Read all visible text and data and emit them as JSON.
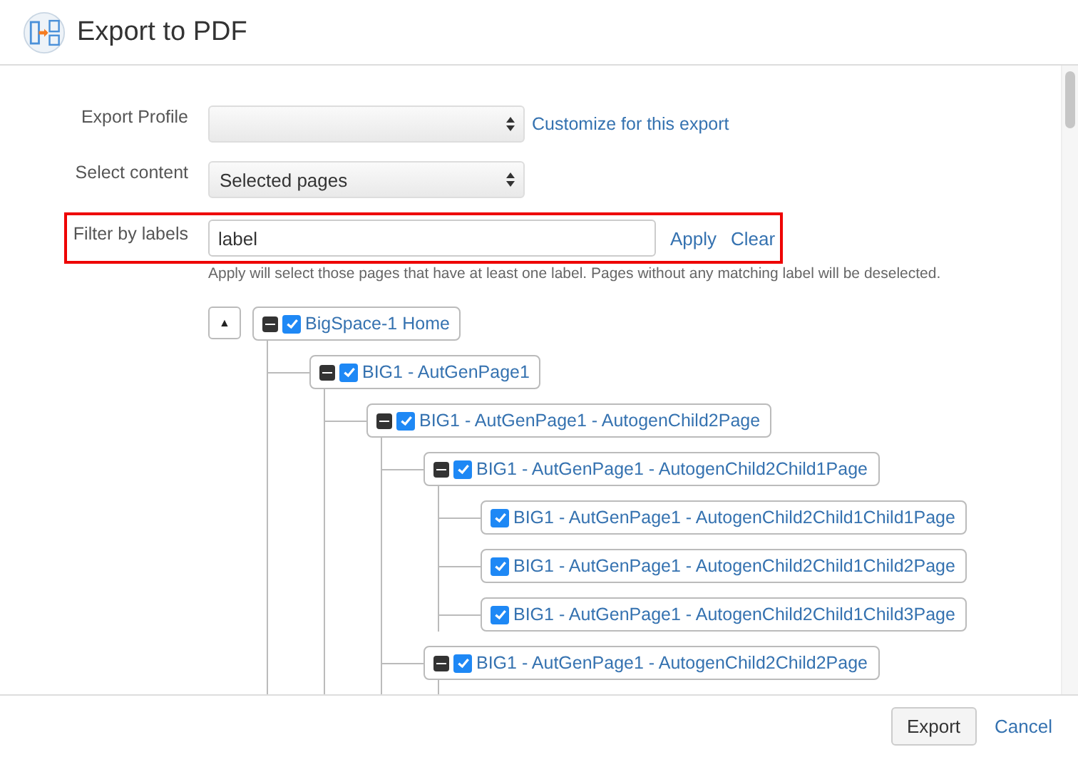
{
  "window": {
    "title": "Export to PDF"
  },
  "form": {
    "export_profile": {
      "label": "Export Profile",
      "link": "Customize for this export"
    },
    "select_content": {
      "label": "Select content",
      "value": "Selected pages"
    },
    "filter": {
      "label": "Filter by labels",
      "value": "label",
      "highlighted": true,
      "apply": "Apply",
      "clear": "Clear",
      "hint": "Apply will select those pages that have at least one label. Pages without any matching label will be deselected."
    }
  },
  "tree": {
    "collapse_button": "▲",
    "nodes": [
      {
        "title": "BigSpace-1 Home",
        "checked": true,
        "expanded": true,
        "children": [
          {
            "title": "BIG1 - AutGenPage1",
            "checked": true,
            "expanded": true,
            "children": [
              {
                "title": "BIG1 - AutGenPage1 - AutogenChild2Page",
                "checked": true,
                "expanded": true,
                "children": [
                  {
                    "title": "BIG1 - AutGenPage1 - AutogenChild2Child1Page",
                    "checked": true,
                    "expanded": true,
                    "children": [
                      {
                        "title": "BIG1 - AutGenPage1 - AutogenChild2Child1Child1Page",
                        "checked": true,
                        "expanded": false
                      },
                      {
                        "title": "BIG1 - AutGenPage1 - AutogenChild2Child1Child2Page",
                        "checked": true,
                        "expanded": false
                      },
                      {
                        "title": "BIG1 - AutGenPage1 - AutogenChild2Child1Child3Page",
                        "checked": true,
                        "expanded": false
                      }
                    ]
                  },
                  {
                    "title": "BIG1 - AutGenPage1 - AutogenChild2Child2Page",
                    "checked": true,
                    "expanded": true
                  }
                ]
              }
            ]
          }
        ]
      }
    ]
  },
  "footer": {
    "buttons": [
      "Export"
    ],
    "cancel": "Cancel"
  }
}
